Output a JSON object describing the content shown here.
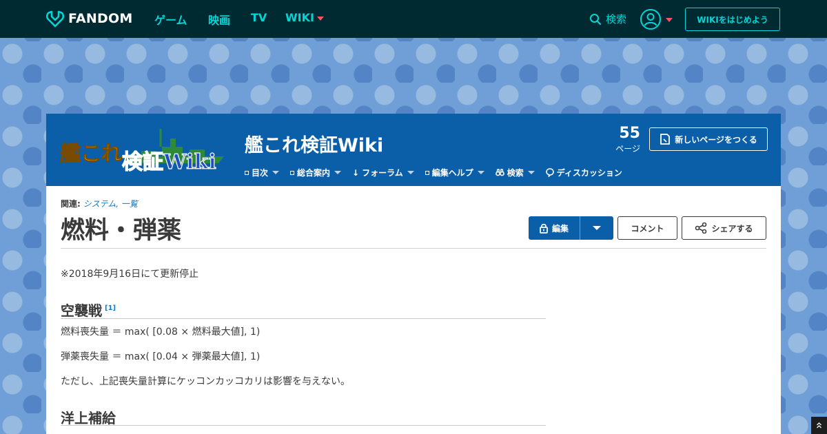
{
  "global_nav": {
    "logo_text": "FANDOM",
    "links": {
      "games": "ゲーム",
      "movies": "映画",
      "tv": "TV",
      "wiki": "WIKI"
    },
    "search_label": "検索",
    "start_wiki_label": "WIKIをはじめよう"
  },
  "community": {
    "wordmark_top": "艦これ",
    "wordmark_bottom": "検証Wiki",
    "name": "艦これ検証Wiki",
    "page_count": "55",
    "page_count_label": "ページ",
    "new_page_label": "新しいページをつくる",
    "nav": {
      "toc": "目次",
      "guide": "総合案内",
      "forum": "フォーラム",
      "edit_help": "編集ヘルプ",
      "search": "検索",
      "discussion": "ディスカッション"
    }
  },
  "page": {
    "related_label": "関連:",
    "related_links": "システム, 一覧",
    "title": "燃料・弾薬",
    "edit_label": "編集",
    "comment_label": "コメント",
    "share_label": "シェアする",
    "notice": "※2018年9月16日にて更新停止",
    "section1": {
      "heading": "空襲戦",
      "ref": "[1]",
      "lines": [
        "燃料喪失量 ＝ max( [0.08 × 燃料最大値], 1)",
        "弾薬喪失量 ＝ max( [0.04 × 弾薬最大値], 1)",
        "ただし、上記喪失量計算にケッコンカッコカリは影響を与えない。"
      ]
    },
    "section2": {
      "heading": "洋上補給"
    }
  },
  "colors": {
    "global_nav_bg": "#002a32",
    "accent_cyan": "#00d6d6",
    "community_blue": "#0b5fa8",
    "caret_pink": "#fd5464"
  }
}
